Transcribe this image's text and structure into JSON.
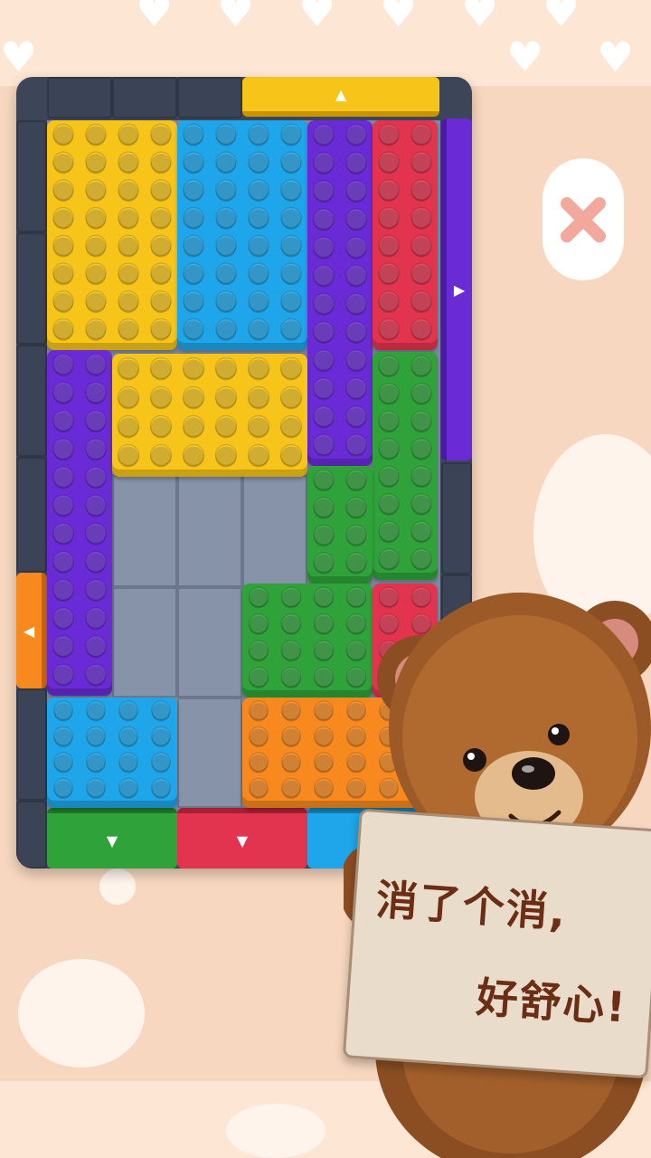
{
  "game": {
    "banner_line1": "消了个消,",
    "banner_line2": "好舒心!"
  },
  "colors": {
    "yellow": "#f7c51a",
    "blue": "#1fa6ea",
    "purple": "#6a2bd6",
    "red": "#e3344f",
    "green": "#2fa33a",
    "orange": "#f7891e",
    "wall": "#3d4659",
    "floor": "#8793a9",
    "background": "#f7d7bf"
  },
  "gates": [
    {
      "name": "top-yellow-gate",
      "color": "yellow",
      "arrow": "▲"
    },
    {
      "name": "right-purple-gate",
      "color": "purple",
      "arrow": "▶"
    },
    {
      "name": "left-orange-gate",
      "color": "orange",
      "arrow": "◀"
    },
    {
      "name": "bottom-green-gate",
      "color": "green",
      "arrow": "▼"
    },
    {
      "name": "bottom-red-gate",
      "color": "red",
      "arrow": "▼"
    },
    {
      "name": "bottom-blue-gate",
      "color": "blue",
      "arrow": "▼"
    }
  ],
  "blocks": [
    {
      "name": "yellow-block-large",
      "color": "yellow"
    },
    {
      "name": "blue-block-large",
      "color": "blue"
    },
    {
      "name": "purple-block-tall",
      "color": "purple"
    },
    {
      "name": "red-block-top",
      "color": "red"
    },
    {
      "name": "purple-block-left",
      "color": "purple"
    },
    {
      "name": "yellow-block-wide",
      "color": "yellow"
    },
    {
      "name": "green-block-right",
      "color": "green"
    },
    {
      "name": "green-block-l",
      "color": "green"
    },
    {
      "name": "red-block-small",
      "color": "red"
    },
    {
      "name": "blue-block-bottom",
      "color": "blue"
    },
    {
      "name": "orange-block-bottom",
      "color": "orange"
    }
  ]
}
